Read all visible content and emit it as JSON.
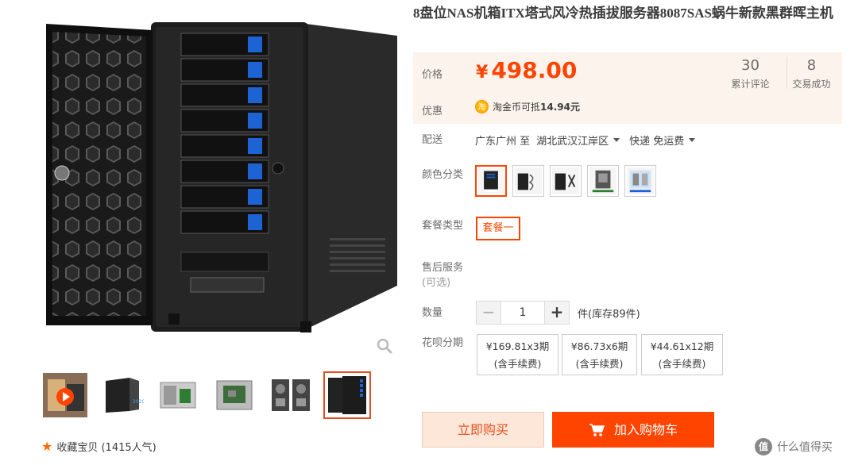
{
  "product": {
    "title": "8盘位NAS机箱ITX塔式风冷热插拔服务器8087SAS蜗牛新款黑群晖主机"
  },
  "gallery": {
    "main_image": "nas-case-black-8-bay-open-door",
    "zoom_icon": "magnifier-icon",
    "thumbnails": [
      {
        "name": "video-thumb",
        "icon": "play-icon"
      },
      {
        "name": "case-front-thumb"
      },
      {
        "name": "case-inside-thumb"
      },
      {
        "name": "case-board-thumb"
      },
      {
        "name": "case-back-thumb"
      },
      {
        "name": "case-door-open-thumb",
        "active": true
      }
    ],
    "favorite_label": "收藏宝贝 (1415人气)",
    "favorite_icon": "star-icon"
  },
  "price": {
    "label": "价格",
    "currency": "¥",
    "value": "498.00",
    "reviews_count": "30",
    "reviews_label": "累计评论",
    "trades_count": "8",
    "trades_label": "交易成功",
    "promo_label": "优惠",
    "promo_icon": "淘",
    "promo_text": "淘金币可抵",
    "promo_amount": "14.94元"
  },
  "shipping": {
    "label": "配送",
    "from": "广东广州 至",
    "to": "湖北武汉江岸区",
    "method": "快递 免运费"
  },
  "color": {
    "label": "颜色分类",
    "options": [
      {
        "name": "black-case",
        "active": true
      },
      {
        "name": "case-with-cable"
      },
      {
        "name": "case-with-accessory"
      },
      {
        "name": "case-plus-psu-480w"
      },
      {
        "name": "case-plus-psu-blue"
      }
    ]
  },
  "package": {
    "label": "套餐类型",
    "option": "套餐一"
  },
  "service": {
    "label_line1": "售后服务",
    "label_line2": "(可选)"
  },
  "quantity": {
    "label": "数量",
    "minus": "−",
    "value": "1",
    "plus": "+",
    "stock": "件(库存89件)"
  },
  "installment": {
    "label": "花呗分期",
    "options": [
      {
        "line1": "¥169.81x3期",
        "line2": "(含手续费)"
      },
      {
        "line1": "¥86.73x6期",
        "line2": "(含手续费)"
      },
      {
        "line1": "¥44.61x12期",
        "line2": "(含手续费)"
      }
    ]
  },
  "actions": {
    "buy_now": "立即购买",
    "add_to_cart": "加入购物车"
  },
  "watermark": {
    "logo": "值",
    "text": "什么值得买"
  },
  "colors": {
    "accent": "#ff4400",
    "price_bg": "#fcf3ec",
    "buy_bg": "#fde7d9"
  }
}
